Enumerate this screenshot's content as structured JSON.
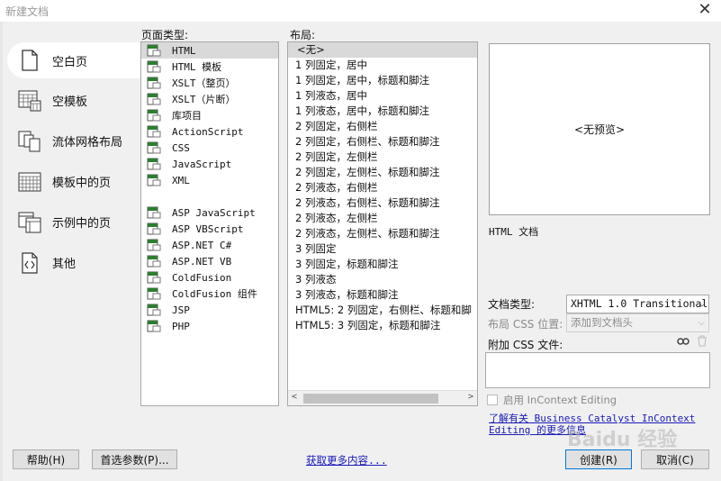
{
  "window": {
    "title": "新建文档",
    "close_glyph": "✕"
  },
  "categories": [
    {
      "label": "空白页",
      "icon": "blank-page-icon",
      "selected": true
    },
    {
      "label": "空模板",
      "icon": "template-grid-icon"
    },
    {
      "label": "流体网格布局",
      "icon": "fluid-grid-icon"
    },
    {
      "label": "模板中的页",
      "icon": "template-page-icon"
    },
    {
      "label": "示例中的页",
      "icon": "sample-page-icon"
    },
    {
      "label": "其他",
      "icon": "code-file-icon"
    }
  ],
  "page_type": {
    "label": "页面类型:",
    "items": [
      "HTML",
      "HTML 模板",
      "XSLT（整页）",
      "XSLT（片断）",
      "库项目",
      "ActionScript",
      "CSS",
      "JavaScript",
      "XML",
      "",
      "ASP JavaScript",
      "ASP VBScript",
      "ASP.NET C#",
      "ASP.NET VB",
      "ColdFusion",
      "ColdFusion 组件",
      "JSP",
      "PHP"
    ]
  },
  "layout": {
    "label": "布局:",
    "items": [
      "<无>",
      "1 列固定，居中",
      "1 列固定，居中，标题和脚注",
      "1 列液态，居中",
      "1 列液态，居中，标题和脚注",
      "2 列固定，右侧栏",
      "2 列固定，右侧栏、标题和脚注",
      "2 列固定，左侧栏",
      "2 列固定，左侧栏、标题和脚注",
      "2 列液态，右侧栏",
      "2 列液态，右侧栏、标题和脚注",
      "2 列液态，左侧栏",
      "2 列液态，左侧栏、标题和脚注",
      "3 列固定",
      "3 列固定，标题和脚注",
      "3 列液态",
      "3 列液态，标题和脚注",
      "HTML5: 2 列固定，右侧栏、标题和脚",
      "HTML5: 3 列固定，标题和脚注"
    ]
  },
  "preview": {
    "text": "<无预览>",
    "description": "HTML 文档"
  },
  "doctype": {
    "label": "文档类型:",
    "value": "XHTML 1.0 Transitional"
  },
  "layout_css": {
    "label": "布局 CSS 位置:",
    "value": "添加到文档头"
  },
  "attach_css": {
    "label": "附加 CSS 文件:"
  },
  "incontext": {
    "label": "启用 InContext Editing"
  },
  "learn_more": "了解有关 Business Catalyst InContext Editing 的更多信息",
  "buttons": {
    "help": "帮助(H)",
    "prefs": "首选参数(P)...",
    "get_more": "获取更多内容...",
    "create": "创建(R)",
    "cancel": "取消(C)"
  },
  "watermark": "Baidu 经验"
}
